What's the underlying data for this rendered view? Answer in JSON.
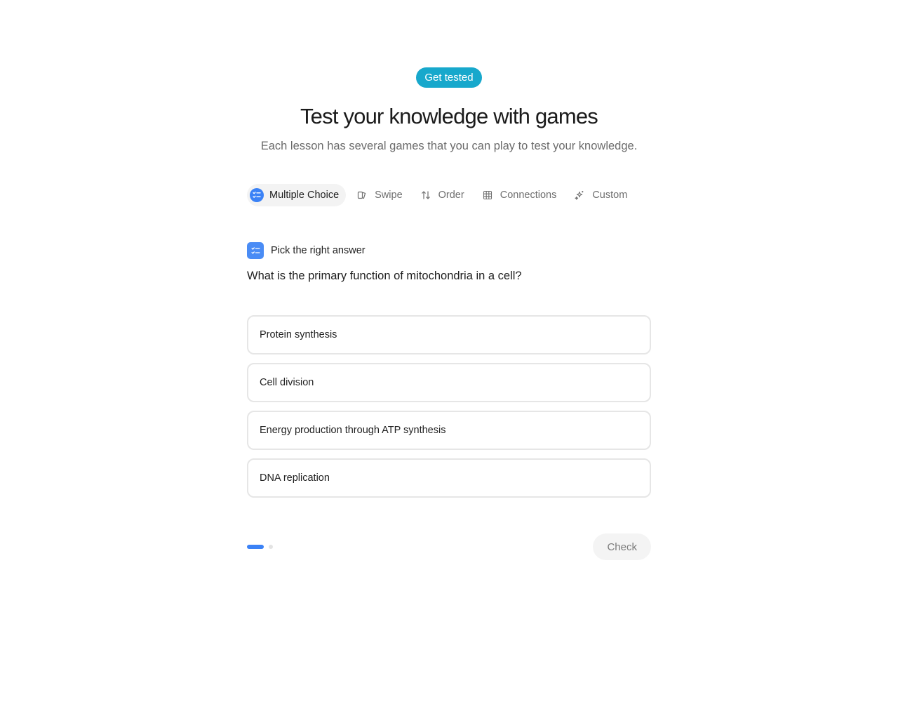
{
  "hero": {
    "badge": "Get tested",
    "title": "Test your knowledge with games",
    "subtitle": "Each lesson has several games that you can play to test your knowledge."
  },
  "tabs": [
    {
      "label": "Multiple Choice",
      "icon": "checklist-icon",
      "active": true
    },
    {
      "label": "Swipe",
      "icon": "swipe-cards-icon",
      "active": false
    },
    {
      "label": "Order",
      "icon": "sort-arrows-icon",
      "active": false
    },
    {
      "label": "Connections",
      "icon": "grid-icon",
      "active": false
    },
    {
      "label": "Custom",
      "icon": "sparkles-icon",
      "active": false
    }
  ],
  "question": {
    "instruction": "Pick the right answer",
    "text": "What is the primary function of mitochondria in a cell?",
    "options": [
      "Protein synthesis",
      "Cell division",
      "Energy production through ATP synthesis",
      "DNA replication"
    ]
  },
  "footer": {
    "check_label": "Check",
    "current_step": 1,
    "total_steps": 2
  },
  "colors": {
    "badge": "#17a8cc",
    "accent": "#3b82f6"
  }
}
